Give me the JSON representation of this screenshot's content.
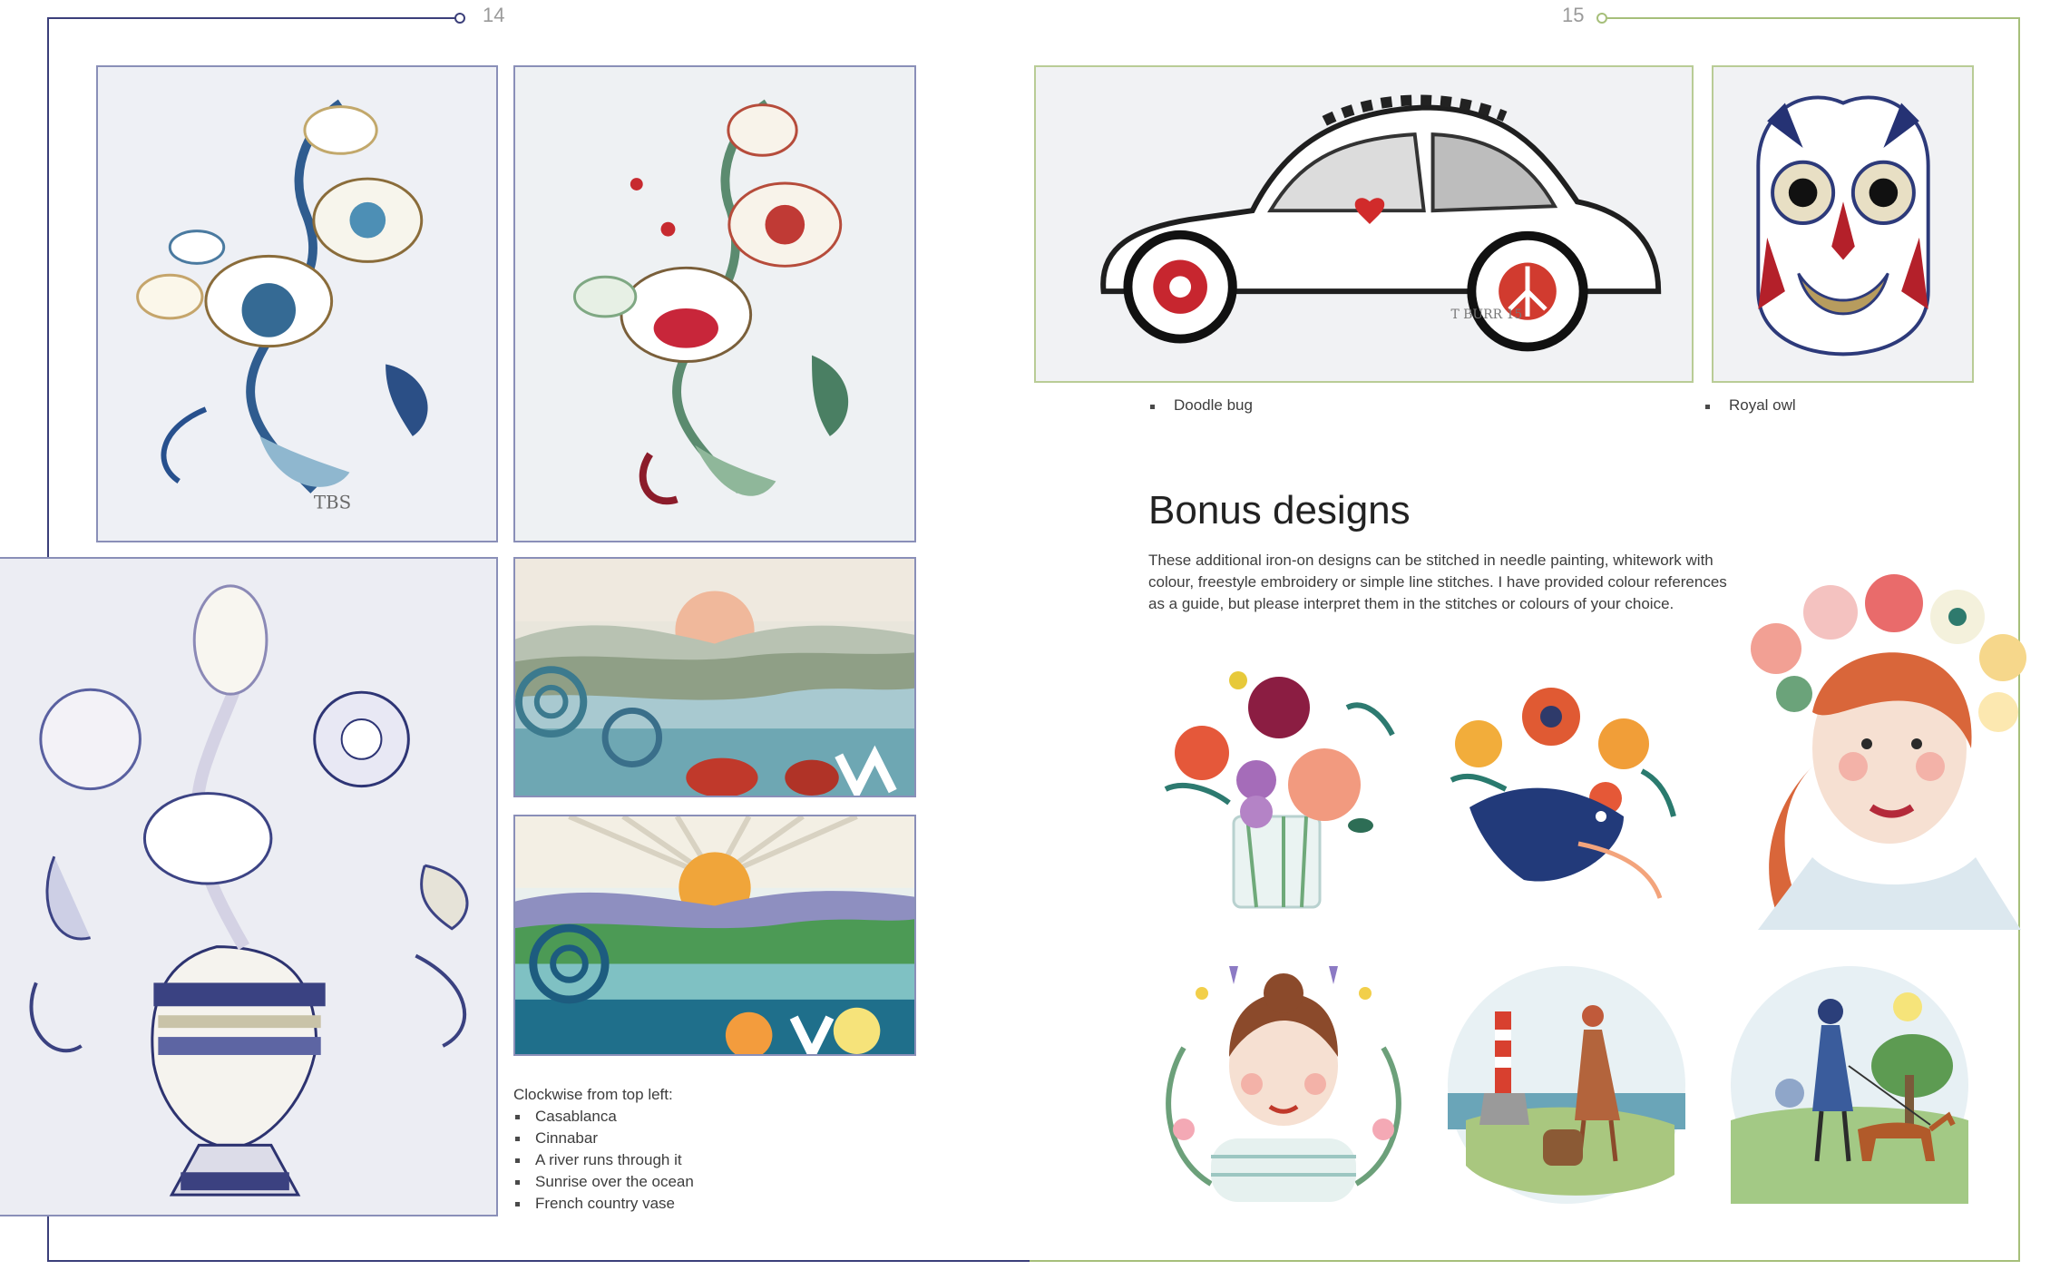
{
  "left_page": {
    "page_number": "14",
    "frame_color": "#3b3f7a",
    "captions": {
      "intro": "Clockwise from top left:",
      "items": [
        "Casablanca",
        "Cinnabar",
        "A river runs through it",
        "Sunrise over the ocean",
        "French country vase"
      ]
    },
    "photos": [
      "casablanca-embroidery",
      "cinnabar-embroidery",
      "river-embroidery",
      "sunrise-embroidery",
      "french-vase-embroidery"
    ]
  },
  "right_page": {
    "page_number": "15",
    "frame_color": "#a6bf7a",
    "captions": {
      "doodle_bug": "Doodle bug",
      "royal_owl": "Royal owl"
    },
    "bonus": {
      "heading": "Bonus designs",
      "body": "These additional iron-on designs can be stitched in needle painting, whitework with colour, freestyle embroidery or simple line stitches. I have provided colour references as a guide, but please interpret them in the stitches or colours of your choice."
    },
    "illustrations": [
      "flower-vase",
      "bird-bouquet",
      "flower-crown-girl",
      "bluebell-wreath-girl",
      "lighthouse-woman",
      "dog-walker"
    ]
  }
}
